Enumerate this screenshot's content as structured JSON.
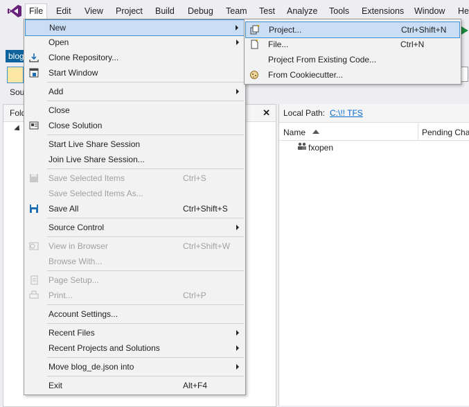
{
  "menubar": {
    "items": [
      "File",
      "Edit",
      "View",
      "Project",
      "Build",
      "Debug",
      "Team",
      "Test",
      "Analyze",
      "Tools",
      "Extensions",
      "Window",
      "He"
    ]
  },
  "doc_tab": "blog",
  "left_panel": {
    "source_label": "Sou",
    "folder_label": "Fold"
  },
  "right_panel": {
    "local_path_label": "Local Path:",
    "local_path_value": "C:\\!! TFS",
    "columns": {
      "name": "Name",
      "pending": "Pending Cha"
    },
    "rows": [
      {
        "name": "fxopen"
      }
    ]
  },
  "file_menu": {
    "items": [
      {
        "label": "New"
      },
      {
        "label": "Open"
      },
      {
        "label": "Clone Repository..."
      },
      {
        "label": "Start Window"
      },
      {
        "label": "Add"
      },
      {
        "label": "Close"
      },
      {
        "label": "Close Solution"
      },
      {
        "label": "Start Live Share Session"
      },
      {
        "label": "Join Live Share Session..."
      },
      {
        "label": "Save Selected Items",
        "shortcut": "Ctrl+S"
      },
      {
        "label": "Save Selected Items As..."
      },
      {
        "label": "Save All",
        "shortcut": "Ctrl+Shift+S"
      },
      {
        "label": "Source Control"
      },
      {
        "label": "View in Browser",
        "shortcut": "Ctrl+Shift+W"
      },
      {
        "label": "Browse With..."
      },
      {
        "label": "Page Setup..."
      },
      {
        "label": "Print...",
        "shortcut": "Ctrl+P"
      },
      {
        "label": "Account Settings..."
      },
      {
        "label": "Recent Files"
      },
      {
        "label": "Recent Projects and Solutions"
      },
      {
        "label": "Move blog_de.json into"
      },
      {
        "label": "Exit",
        "shortcut": "Alt+F4"
      }
    ]
  },
  "new_submenu": {
    "items": [
      {
        "label": "Project...",
        "shortcut": "Ctrl+Shift+N"
      },
      {
        "label": "File...",
        "shortcut": "Ctrl+N"
      },
      {
        "label": "Project From Existing Code..."
      },
      {
        "label": "From Cookiecutter..."
      }
    ]
  },
  "colors": {
    "accent": "#3e8ed0",
    "highlight": "#c9def5",
    "link": "#0066cc",
    "vs_purple": "#68217a"
  }
}
